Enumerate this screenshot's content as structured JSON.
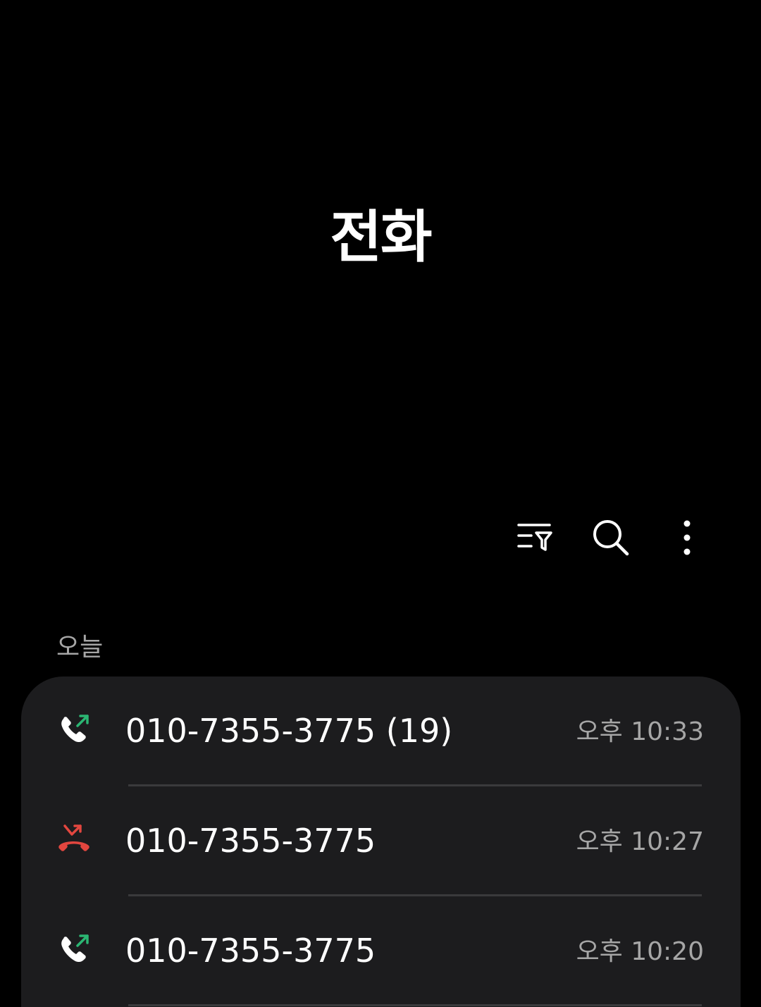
{
  "header": {
    "title": "전화"
  },
  "toolbar": {
    "filter_icon": "filter-list-icon",
    "search_icon": "search-icon",
    "more_icon": "more-vertical-icon"
  },
  "section": {
    "label": "오늘"
  },
  "calls": [
    {
      "number": "010-7355-3775 (19)",
      "time": "오후 10:33",
      "type": "outgoing",
      "icon": "outgoing-call-icon",
      "icon_color": "#2bb673",
      "arrow_color": "#2bb673"
    },
    {
      "number": "010-7355-3775",
      "time": "오후 10:27",
      "type": "missed",
      "icon": "missed-call-icon",
      "icon_color": "#e2463f",
      "arrow_color": "#e2463f"
    },
    {
      "number": "010-7355-3775",
      "time": "오후 10:20",
      "type": "outgoing",
      "icon": "outgoing-call-icon",
      "icon_color": "#2bb673",
      "arrow_color": "#2bb673"
    }
  ],
  "colors": {
    "background": "#000000",
    "card": "#1c1c1e",
    "secondary_text": "#a6a6a6",
    "divider": "#3a3a3c",
    "outgoing": "#2bb673",
    "missed": "#e2463f"
  }
}
